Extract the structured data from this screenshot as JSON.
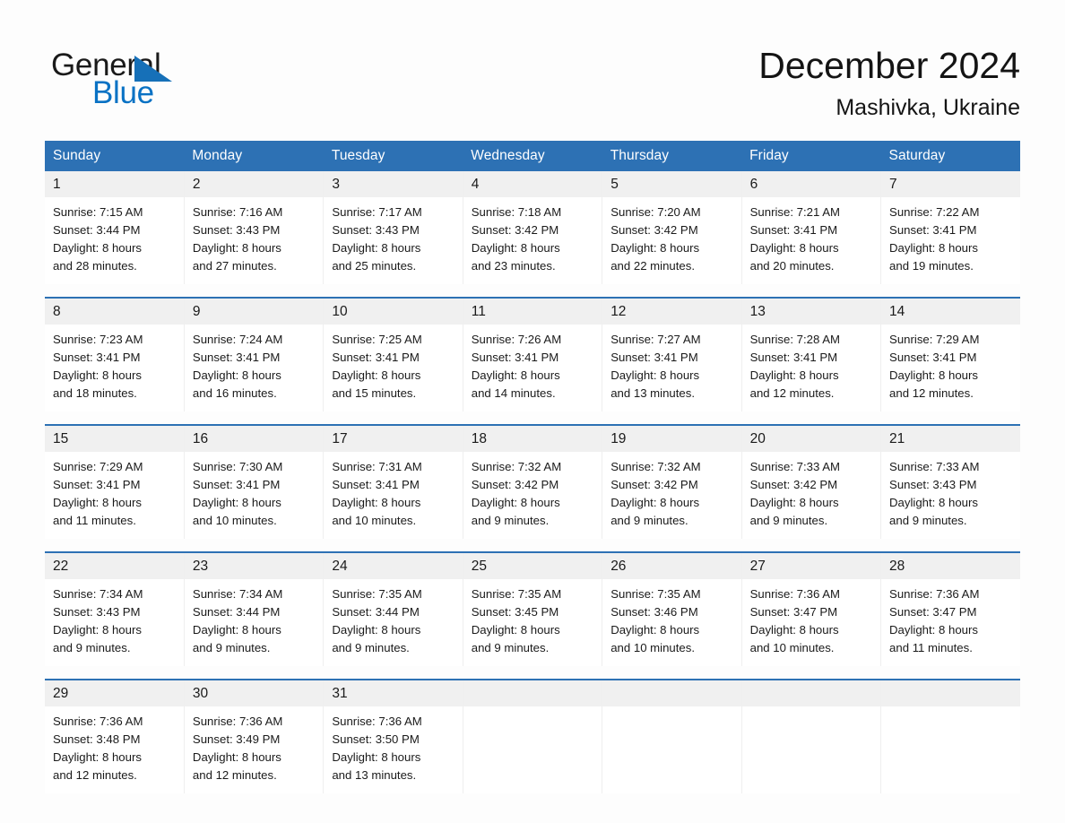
{
  "brand": {
    "name_part1": "General",
    "name_part2": "Blue",
    "triangle_color": "#1670b8",
    "blue_color": "#0a72c4"
  },
  "header": {
    "title": "December 2024",
    "location": "Mashivka, Ukraine"
  },
  "theme": {
    "header_blue": "#2d71b4",
    "daynum_gray": "#f0f0f0",
    "page_bg": "#fdfdfd"
  },
  "weekdays": [
    "Sunday",
    "Monday",
    "Tuesday",
    "Wednesday",
    "Thursday",
    "Friday",
    "Saturday"
  ],
  "weeks": [
    [
      {
        "day": "1",
        "sunrise": "Sunrise: 7:15 AM",
        "sunset": "Sunset: 3:44 PM",
        "daylight1": "Daylight: 8 hours",
        "daylight2": "and 28 minutes."
      },
      {
        "day": "2",
        "sunrise": "Sunrise: 7:16 AM",
        "sunset": "Sunset: 3:43 PM",
        "daylight1": "Daylight: 8 hours",
        "daylight2": "and 27 minutes."
      },
      {
        "day": "3",
        "sunrise": "Sunrise: 7:17 AM",
        "sunset": "Sunset: 3:43 PM",
        "daylight1": "Daylight: 8 hours",
        "daylight2": "and 25 minutes."
      },
      {
        "day": "4",
        "sunrise": "Sunrise: 7:18 AM",
        "sunset": "Sunset: 3:42 PM",
        "daylight1": "Daylight: 8 hours",
        "daylight2": "and 23 minutes."
      },
      {
        "day": "5",
        "sunrise": "Sunrise: 7:20 AM",
        "sunset": "Sunset: 3:42 PM",
        "daylight1": "Daylight: 8 hours",
        "daylight2": "and 22 minutes."
      },
      {
        "day": "6",
        "sunrise": "Sunrise: 7:21 AM",
        "sunset": "Sunset: 3:41 PM",
        "daylight1": "Daylight: 8 hours",
        "daylight2": "and 20 minutes."
      },
      {
        "day": "7",
        "sunrise": "Sunrise: 7:22 AM",
        "sunset": "Sunset: 3:41 PM",
        "daylight1": "Daylight: 8 hours",
        "daylight2": "and 19 minutes."
      }
    ],
    [
      {
        "day": "8",
        "sunrise": "Sunrise: 7:23 AM",
        "sunset": "Sunset: 3:41 PM",
        "daylight1": "Daylight: 8 hours",
        "daylight2": "and 18 minutes."
      },
      {
        "day": "9",
        "sunrise": "Sunrise: 7:24 AM",
        "sunset": "Sunset: 3:41 PM",
        "daylight1": "Daylight: 8 hours",
        "daylight2": "and 16 minutes."
      },
      {
        "day": "10",
        "sunrise": "Sunrise: 7:25 AM",
        "sunset": "Sunset: 3:41 PM",
        "daylight1": "Daylight: 8 hours",
        "daylight2": "and 15 minutes."
      },
      {
        "day": "11",
        "sunrise": "Sunrise: 7:26 AM",
        "sunset": "Sunset: 3:41 PM",
        "daylight1": "Daylight: 8 hours",
        "daylight2": "and 14 minutes."
      },
      {
        "day": "12",
        "sunrise": "Sunrise: 7:27 AM",
        "sunset": "Sunset: 3:41 PM",
        "daylight1": "Daylight: 8 hours",
        "daylight2": "and 13 minutes."
      },
      {
        "day": "13",
        "sunrise": "Sunrise: 7:28 AM",
        "sunset": "Sunset: 3:41 PM",
        "daylight1": "Daylight: 8 hours",
        "daylight2": "and 12 minutes."
      },
      {
        "day": "14",
        "sunrise": "Sunrise: 7:29 AM",
        "sunset": "Sunset: 3:41 PM",
        "daylight1": "Daylight: 8 hours",
        "daylight2": "and 12 minutes."
      }
    ],
    [
      {
        "day": "15",
        "sunrise": "Sunrise: 7:29 AM",
        "sunset": "Sunset: 3:41 PM",
        "daylight1": "Daylight: 8 hours",
        "daylight2": "and 11 minutes."
      },
      {
        "day": "16",
        "sunrise": "Sunrise: 7:30 AM",
        "sunset": "Sunset: 3:41 PM",
        "daylight1": "Daylight: 8 hours",
        "daylight2": "and 10 minutes."
      },
      {
        "day": "17",
        "sunrise": "Sunrise: 7:31 AM",
        "sunset": "Sunset: 3:41 PM",
        "daylight1": "Daylight: 8 hours",
        "daylight2": "and 10 minutes."
      },
      {
        "day": "18",
        "sunrise": "Sunrise: 7:32 AM",
        "sunset": "Sunset: 3:42 PM",
        "daylight1": "Daylight: 8 hours",
        "daylight2": "and 9 minutes."
      },
      {
        "day": "19",
        "sunrise": "Sunrise: 7:32 AM",
        "sunset": "Sunset: 3:42 PM",
        "daylight1": "Daylight: 8 hours",
        "daylight2": "and 9 minutes."
      },
      {
        "day": "20",
        "sunrise": "Sunrise: 7:33 AM",
        "sunset": "Sunset: 3:42 PM",
        "daylight1": "Daylight: 8 hours",
        "daylight2": "and 9 minutes."
      },
      {
        "day": "21",
        "sunrise": "Sunrise: 7:33 AM",
        "sunset": "Sunset: 3:43 PM",
        "daylight1": "Daylight: 8 hours",
        "daylight2": "and 9 minutes."
      }
    ],
    [
      {
        "day": "22",
        "sunrise": "Sunrise: 7:34 AM",
        "sunset": "Sunset: 3:43 PM",
        "daylight1": "Daylight: 8 hours",
        "daylight2": "and 9 minutes."
      },
      {
        "day": "23",
        "sunrise": "Sunrise: 7:34 AM",
        "sunset": "Sunset: 3:44 PM",
        "daylight1": "Daylight: 8 hours",
        "daylight2": "and 9 minutes."
      },
      {
        "day": "24",
        "sunrise": "Sunrise: 7:35 AM",
        "sunset": "Sunset: 3:44 PM",
        "daylight1": "Daylight: 8 hours",
        "daylight2": "and 9 minutes."
      },
      {
        "day": "25",
        "sunrise": "Sunrise: 7:35 AM",
        "sunset": "Sunset: 3:45 PM",
        "daylight1": "Daylight: 8 hours",
        "daylight2": "and 9 minutes."
      },
      {
        "day": "26",
        "sunrise": "Sunrise: 7:35 AM",
        "sunset": "Sunset: 3:46 PM",
        "daylight1": "Daylight: 8 hours",
        "daylight2": "and 10 minutes."
      },
      {
        "day": "27",
        "sunrise": "Sunrise: 7:36 AM",
        "sunset": "Sunset: 3:47 PM",
        "daylight1": "Daylight: 8 hours",
        "daylight2": "and 10 minutes."
      },
      {
        "day": "28",
        "sunrise": "Sunrise: 7:36 AM",
        "sunset": "Sunset: 3:47 PM",
        "daylight1": "Daylight: 8 hours",
        "daylight2": "and 11 minutes."
      }
    ],
    [
      {
        "day": "29",
        "sunrise": "Sunrise: 7:36 AM",
        "sunset": "Sunset: 3:48 PM",
        "daylight1": "Daylight: 8 hours",
        "daylight2": "and 12 minutes."
      },
      {
        "day": "30",
        "sunrise": "Sunrise: 7:36 AM",
        "sunset": "Sunset: 3:49 PM",
        "daylight1": "Daylight: 8 hours",
        "daylight2": "and 12 minutes."
      },
      {
        "day": "31",
        "sunrise": "Sunrise: 7:36 AM",
        "sunset": "Sunset: 3:50 PM",
        "daylight1": "Daylight: 8 hours",
        "daylight2": "and 13 minutes."
      },
      {
        "day": "",
        "sunrise": "",
        "sunset": "",
        "daylight1": "",
        "daylight2": ""
      },
      {
        "day": "",
        "sunrise": "",
        "sunset": "",
        "daylight1": "",
        "daylight2": ""
      },
      {
        "day": "",
        "sunrise": "",
        "sunset": "",
        "daylight1": "",
        "daylight2": ""
      },
      {
        "day": "",
        "sunrise": "",
        "sunset": "",
        "daylight1": "",
        "daylight2": ""
      }
    ]
  ]
}
